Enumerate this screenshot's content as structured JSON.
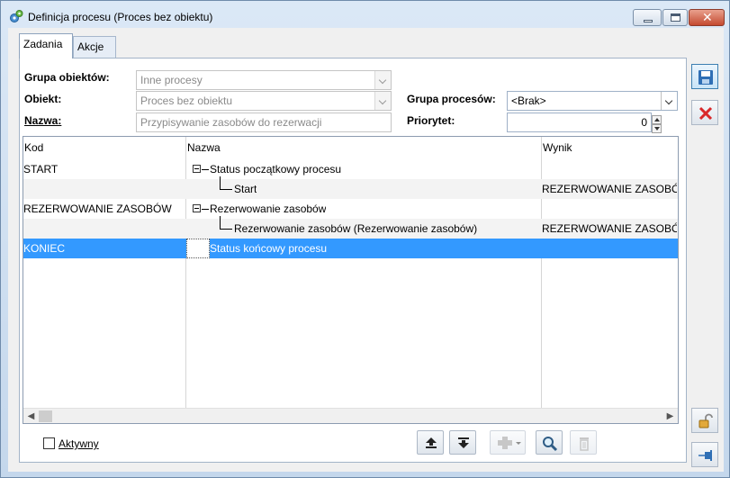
{
  "window": {
    "title": "Definicja procesu (Proces bez obiektu)"
  },
  "tabs": [
    {
      "label": "Zadania"
    },
    {
      "label": "Akcje"
    }
  ],
  "form": {
    "grupa_obiektow_label": "Grupa obiektów:",
    "grupa_obiektow_value": "Inne procesy",
    "obiekt_label": "Obiekt:",
    "obiekt_value": "Proces bez obiektu",
    "nazwa_label": "Nazwa:",
    "nazwa_value": "Przypisywanie zasobów do rezerwacji",
    "grupa_procesow_label": "Grupa procesów:",
    "grupa_procesow_value": "<Brak>",
    "priorytet_label": "Priorytet:",
    "priorytet_value": "0"
  },
  "grid": {
    "columns": [
      "Kod",
      "Nazwa",
      "Wynik"
    ],
    "rows": [
      {
        "kod": "START",
        "nazwa": "Status początkowy procesu",
        "wynik": "",
        "level": 0
      },
      {
        "kod": "",
        "nazwa": "Start",
        "wynik": "REZERWOWANIE ZASOBÓW",
        "level": 1
      },
      {
        "kod": "REZERWOWANIE ZASOBÓW",
        "nazwa": "Rezerwowanie zasobów",
        "wynik": "",
        "level": 0
      },
      {
        "kod": "",
        "nazwa": "Rezerwowanie zasobów (Rezerwowanie zasobów)",
        "wynik": "REZERWOWANIE ZASOBÓW",
        "level": 1
      },
      {
        "kod": "KONIEC",
        "nazwa": "Status końcowy procesu",
        "wynik": "",
        "level": 0,
        "selected": true
      }
    ]
  },
  "footer": {
    "aktywny_label": "Aktywny",
    "aktywny_checked": false
  },
  "colors": {
    "selection": "#3399ff",
    "accent_blue": "#2f6fb5",
    "cancel_red": "#d9282a"
  },
  "icons": {
    "toolbar": [
      "move-up-icon",
      "move-down-icon",
      "add-icon",
      "dropdown-arrow-icon",
      "search-icon",
      "delete-icon"
    ],
    "side": [
      "save-icon",
      "cancel-icon",
      "unlock-icon",
      "pin-icon"
    ]
  }
}
